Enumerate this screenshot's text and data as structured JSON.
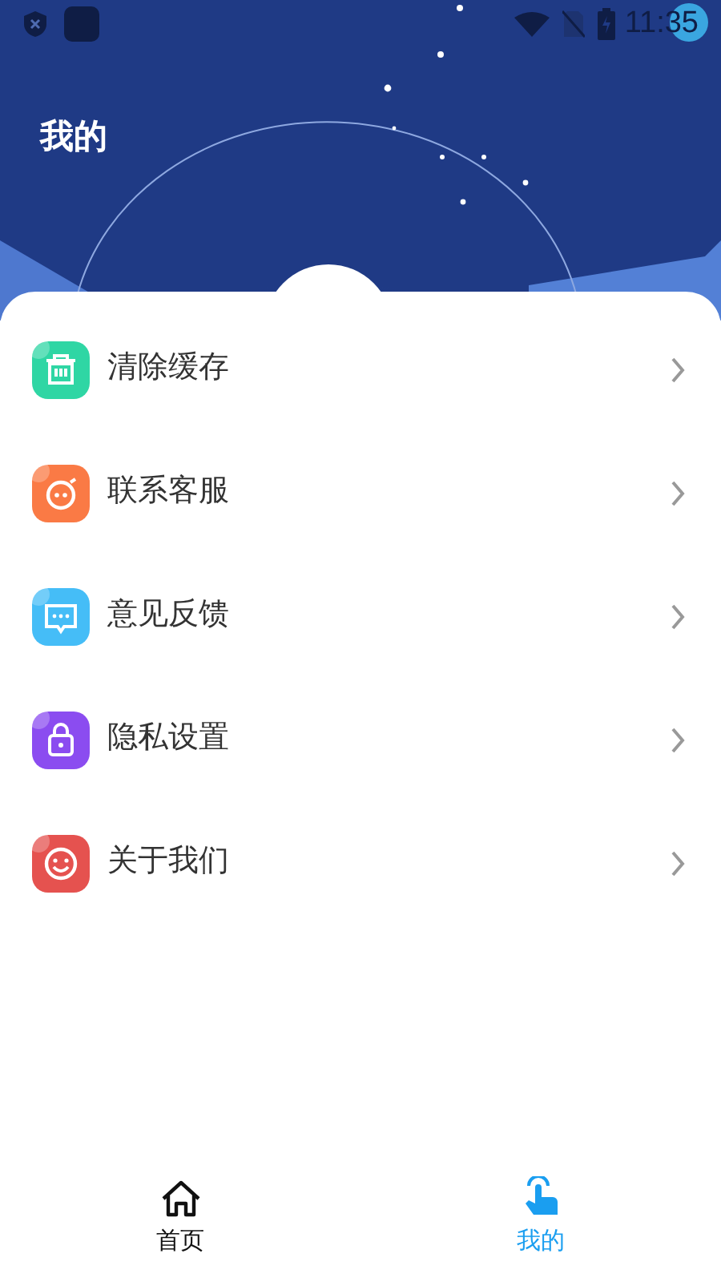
{
  "status_bar": {
    "time": "11:35"
  },
  "header": {
    "title": "我的"
  },
  "menu": [
    {
      "label": "清除缓存",
      "kind": "basket",
      "color": "#2fd6a4"
    },
    {
      "label": "联系客服",
      "kind": "face",
      "color": "#fa7a45"
    },
    {
      "label": "意见反馈",
      "kind": "message",
      "color": "#45bdf7"
    },
    {
      "label": "隐私设置",
      "kind": "lock",
      "color": "#8b4cf0"
    },
    {
      "label": "关于我们",
      "kind": "smile",
      "color": "#e5524f"
    }
  ],
  "tab_bar": [
    {
      "label": "首页",
      "kind": "home",
      "selected": false
    },
    {
      "label": "我的",
      "kind": "touch",
      "selected": true
    }
  ]
}
